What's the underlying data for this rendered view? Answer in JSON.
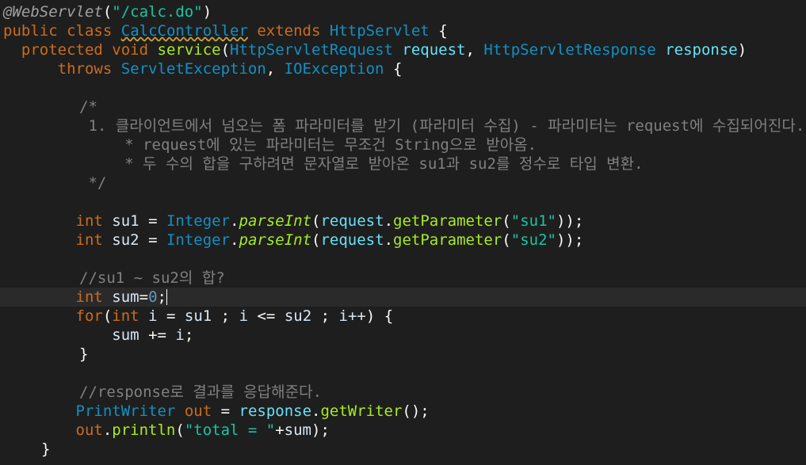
{
  "lines": {
    "l1": {
      "anno": "@WebServlet",
      "p1": "(",
      "str": "\"/calc.do\"",
      "p2": ")"
    },
    "l2": {
      "kw1": "public",
      "kw2": "class",
      "cls": "CalcController",
      "kw3": "extends",
      "sup": "HttpServlet",
      "brace": "{"
    },
    "l3": {
      "kw1": "protected",
      "kw2": "void",
      "name": "service",
      "p1": "(",
      "t1": "HttpServletRequest",
      "v1": "request",
      "comma": ",",
      "t2": "HttpServletResponse",
      "v2": "response",
      "p2": ")"
    },
    "l4": {
      "kw": "throws",
      "e1": "ServletException",
      "comma": ",",
      "e2": "IOException",
      "brace": "{"
    },
    "l6": "/*",
    "l7": " 1. 클라이언트에서 넘오는 폼 파라미터를 받기 (파라미터 수집) - 파라미터는 request에 수집되어진다.",
    "l8": "     * request에 있는 파라미터는 무조건 String으로 받아옴.",
    "l9": "     * 두 수의 합을 구하려면 문자열로 받아온 su1과 su2를 정수로 타입 변환.",
    "l10": " */",
    "l12": {
      "kw": "int",
      "v": "su1",
      "eq": "=",
      "t": "Integer",
      "dot1": ".",
      "sm": "parseInt",
      "p1": "(",
      "r": "request",
      "dot2": ".",
      "m": "getParameter",
      "p2": "(",
      "s": "\"su1\"",
      "p3": "));"
    },
    "l13": {
      "kw": "int",
      "v": "su2",
      "eq": "=",
      "t": "Integer",
      "dot1": ".",
      "sm": "parseInt",
      "p1": "(",
      "r": "request",
      "dot2": ".",
      "m": "getParameter",
      "p2": "(",
      "s": "\"su2\"",
      "p3": "));"
    },
    "l15": "//su1 ~ su2의 합?",
    "l16": {
      "kw": "int",
      "v": "sum",
      "eq": "=",
      "num": "0",
      "semi": ";"
    },
    "l17": {
      "kw1": "for",
      "p1": "(",
      "kw2": "int",
      "v1": "i",
      "eq": "=",
      "v2": "su1",
      "semi1": ";",
      "v3": "i",
      "le": "<=",
      "v4": "su2",
      "semi2": ";",
      "v5": "i++",
      "p2": ")",
      "brace": "{"
    },
    "l18": {
      "v1": "sum",
      "op": "+=",
      "v2": "i",
      "semi": ";"
    },
    "l19": "}",
    "l21": "//response로 결과를 응답해준다.",
    "l22": {
      "t": "PrintWriter",
      "v": "out",
      "eq": "=",
      "r": "response",
      "dot": ".",
      "m": "getWriter",
      "p": "();"
    },
    "l23": {
      "v": "out",
      "dot": ".",
      "m": "println",
      "p1": "(",
      "s": "\"total = \"",
      "plus": "+",
      "v2": "sum",
      "p2": ");"
    },
    "l24": "}"
  }
}
